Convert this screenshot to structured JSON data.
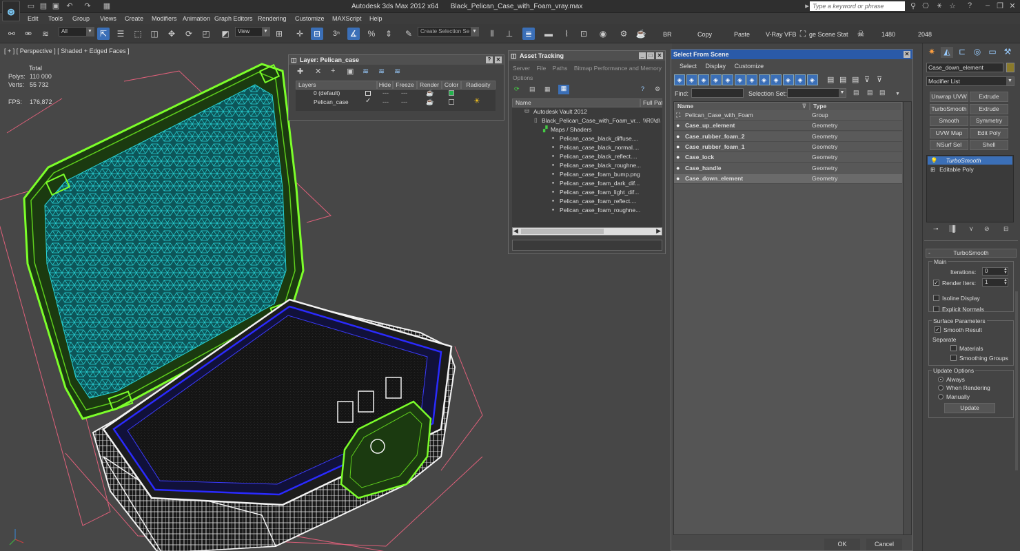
{
  "titlebar": {
    "app_title": "Autodesk 3ds Max  2012 x64",
    "file_title": "Black_Pelican_Case_with_Foam_vray.max",
    "search_placeholder": "Type a keyword or phrase"
  },
  "menu": [
    "Edit",
    "Tools",
    "Group",
    "Views",
    "Create",
    "Modifiers",
    "Animation",
    "Graph Editors",
    "Rendering",
    "Customize",
    "MAXScript",
    "Help"
  ],
  "toolbar": {
    "selection_filter": "All",
    "ref_coord": "View",
    "snap_value": "3",
    "named_selection_placeholder": "Create Selection Se",
    "labels": {
      "br": "BR",
      "copy": "Copy",
      "paste": "Paste",
      "vray_vfb": "V-Ray VFB",
      "scene_states": "ge Scene Stat",
      "width": "1480",
      "height": "2048"
    }
  },
  "viewport": {
    "label": "[ + ] [ Perspective ] [ Shaded + Edged Faces ]",
    "stats": {
      "header": "Total",
      "polys_label": "Polys:",
      "polys": "110 000",
      "verts_label": "Verts:",
      "verts": "55 732",
      "fps_label": "FPS:",
      "fps": "176,872"
    },
    "accent_colors": {
      "wire_green": "#7cff2a",
      "wire_cyan": "#27d3d6",
      "wire_white": "#f2f2f2",
      "wire_blue": "#2a2aff",
      "bbox_pink": "#e0607a"
    }
  },
  "layer_window": {
    "title": "Layer: Pelican_case",
    "columns": [
      "Layers",
      "Hide",
      "Freeze",
      "Render",
      "Color",
      "Radiosity"
    ],
    "rows": [
      {
        "name": "0 (default)",
        "color": "#22b14c"
      },
      {
        "name": "Pelican_case",
        "color": "#333333"
      }
    ]
  },
  "asset_tracking": {
    "title": "Asset Tracking",
    "menu": [
      "Server",
      "File",
      "Paths",
      "Bitmap Performance and Memory",
      "Options"
    ],
    "columns": [
      "Name",
      "Full Path"
    ],
    "root": "Autodesk Vault 2012",
    "file": "Black_Pelican_Case_with_Foam_vr...",
    "file_path": "\\\\R0\\d\\",
    "folder": "Maps / Shaders",
    "maps": [
      "Pelican_case_black_diffuse....",
      "Pelican_case_black_normal....",
      "Pelican_case_black_reflect....",
      "Pelican_case_black_roughne...",
      "Pelican_case_foam_bump.png",
      "Pelican_case_foam_dark_dif...",
      "Pelican_case_foam_light_dif...",
      "Pelican_case_foam_reflect....",
      "Pelican_case_foam_roughne..."
    ]
  },
  "select_from_scene": {
    "title": "Select From Scene",
    "menu": [
      "Select",
      "Display",
      "Customize"
    ],
    "find_label": "Find:",
    "selection_set_label": "Selection Set:",
    "columns": [
      "Name",
      "Type"
    ],
    "rows": [
      {
        "name": "Pelican_Case_with_Foam",
        "type": "Group",
        "bold": false
      },
      {
        "name": "Case_up_element",
        "type": "Geometry",
        "bold": true
      },
      {
        "name": "Case_rubber_foam_2",
        "type": "Geometry",
        "bold": true
      },
      {
        "name": "Case_rubber_foam_1",
        "type": "Geometry",
        "bold": true
      },
      {
        "name": "Case_lock",
        "type": "Geometry",
        "bold": true
      },
      {
        "name": "Case_handle",
        "type": "Geometry",
        "bold": true
      },
      {
        "name": "Case_down_element",
        "type": "Geometry",
        "bold": true,
        "selected": true
      }
    ],
    "ok": "OK",
    "cancel": "Cancel"
  },
  "command_panel": {
    "object_name": "Case_down_element",
    "object_color": "#8a7a2a",
    "modifier_list": "Modifier List",
    "modifier_buttons": [
      "Unwrap UVW",
      "Extrude",
      "TurboSmooth",
      "Extrude",
      "Smooth",
      "Symmetry",
      "UVW Map",
      "Edit Poly",
      "NSurf Sel",
      "Shell"
    ],
    "stack": [
      "TurboSmooth",
      "Editable Poly"
    ],
    "turbosmooth": {
      "rollout_title": "TurboSmooth",
      "main": "Main",
      "iterations_label": "Iterations:",
      "iterations": "0",
      "render_iters_label": "Render Iters:",
      "render_iters": "1",
      "isoline": "Isoline Display",
      "explicit_normals": "Explicit Normals",
      "surface_params": "Surface Parameters",
      "smooth_result": "Smooth Result",
      "separate": "Separate",
      "materials": "Materials",
      "smoothing_groups": "Smoothing Groups",
      "update_options": "Update Options",
      "always": "Always",
      "when_rendering": "When Rendering",
      "manually": "Manually",
      "update_button": "Update"
    }
  }
}
